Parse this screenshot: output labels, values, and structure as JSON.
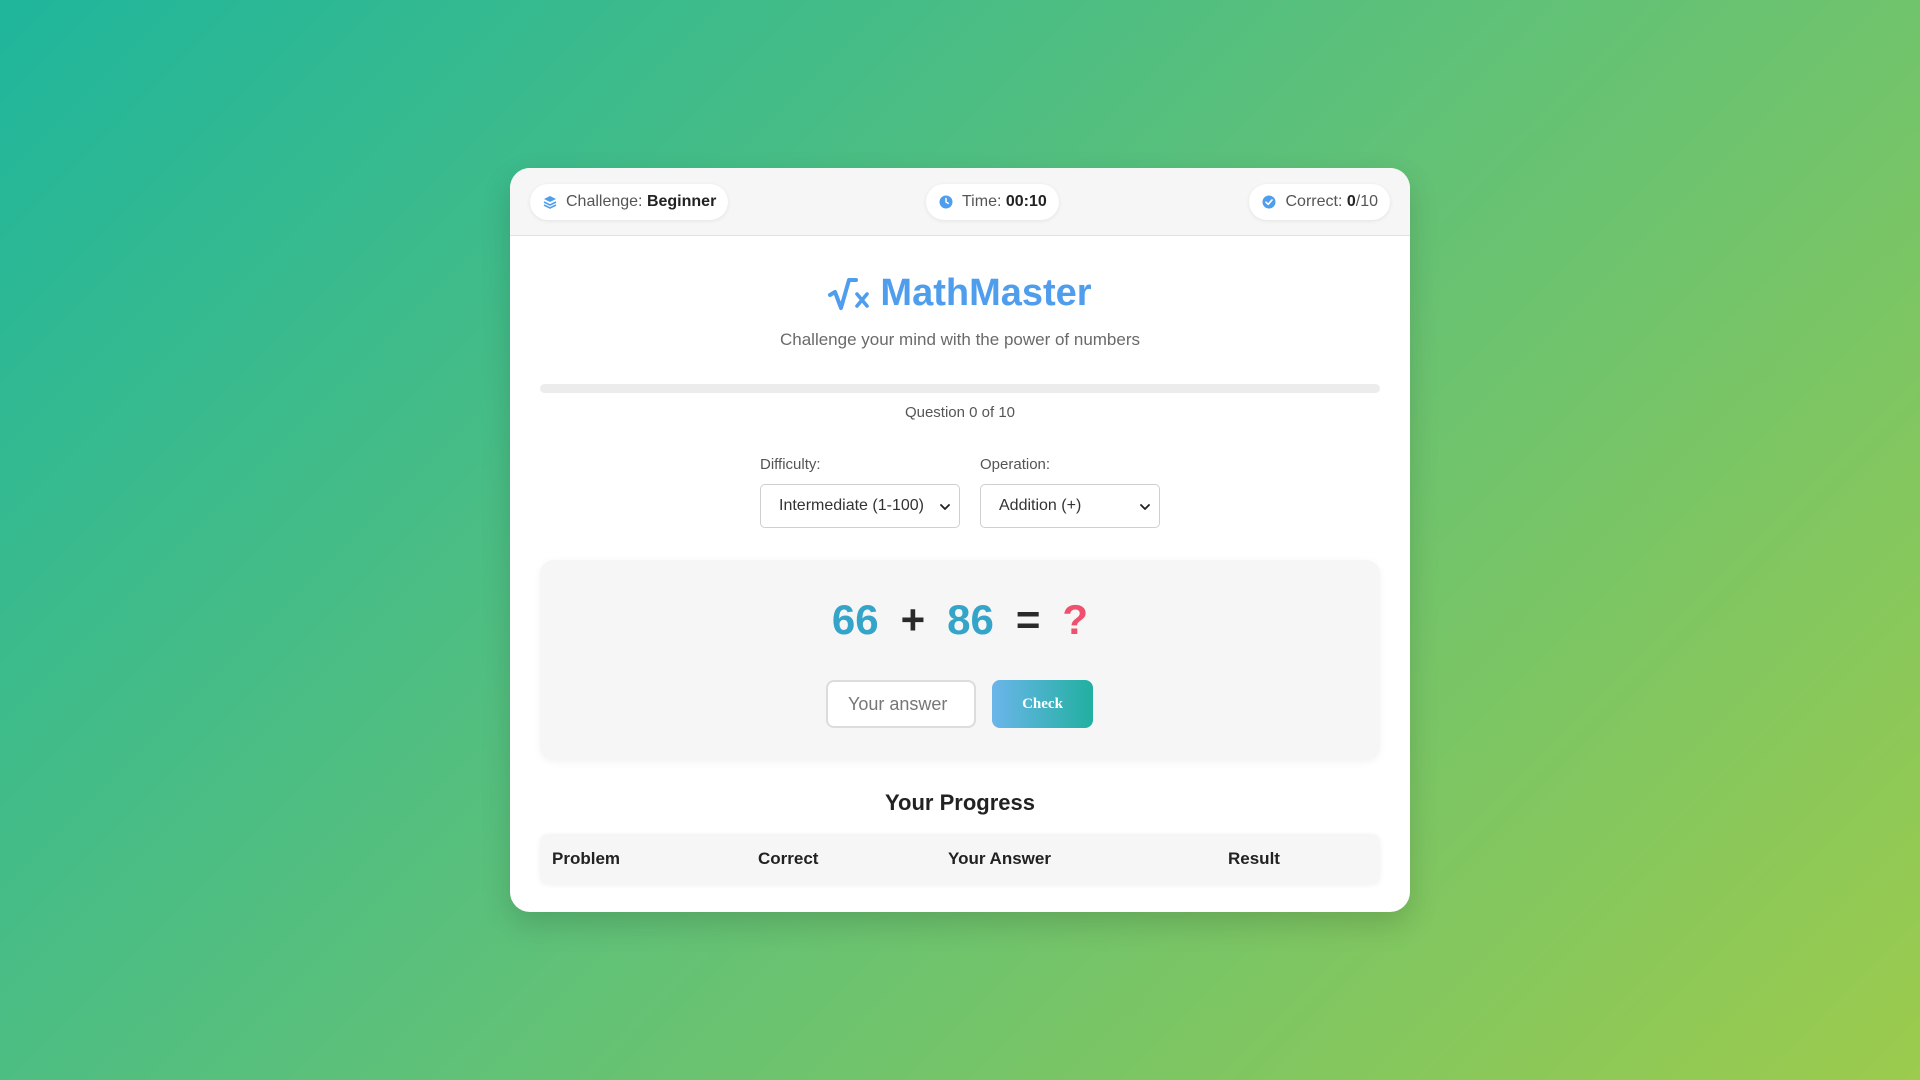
{
  "topbar": {
    "challenge": {
      "label": "Challenge:",
      "value": "Beginner",
      "icon": "layers-icon"
    },
    "time": {
      "label": "Time:",
      "value": "00:10",
      "icon": "clock-icon"
    },
    "correct": {
      "label": "Correct:",
      "value": "0",
      "total": "/10",
      "icon": "check-circle-icon"
    }
  },
  "header": {
    "title": "MathMaster",
    "logo_icon": "square-root-x-icon",
    "subtitle": "Challenge your mind with the power of numbers"
  },
  "progress": {
    "fraction": 0,
    "label": "Question 0 of 10"
  },
  "settings": {
    "difficulty_label": "Difficulty:",
    "difficulty_value": "Intermediate (1-100)",
    "operation_label": "Operation:",
    "operation_value": "Addition (+)"
  },
  "problem": {
    "operand1": "66",
    "operator": "+",
    "operand2": "86",
    "equals": "=",
    "unknown": "?",
    "answer_placeholder": "Your answer",
    "check_label": "Check"
  },
  "results": {
    "title": "Your Progress",
    "columns": [
      "Problem",
      "Correct",
      "Your Answer",
      "Result"
    ]
  },
  "colors": {
    "accent": "#4f9ded",
    "number": "#34a4c8",
    "unknown": "#f0506e",
    "gradient_start": "#6bb5ea",
    "gradient_end": "#21b0a0"
  }
}
